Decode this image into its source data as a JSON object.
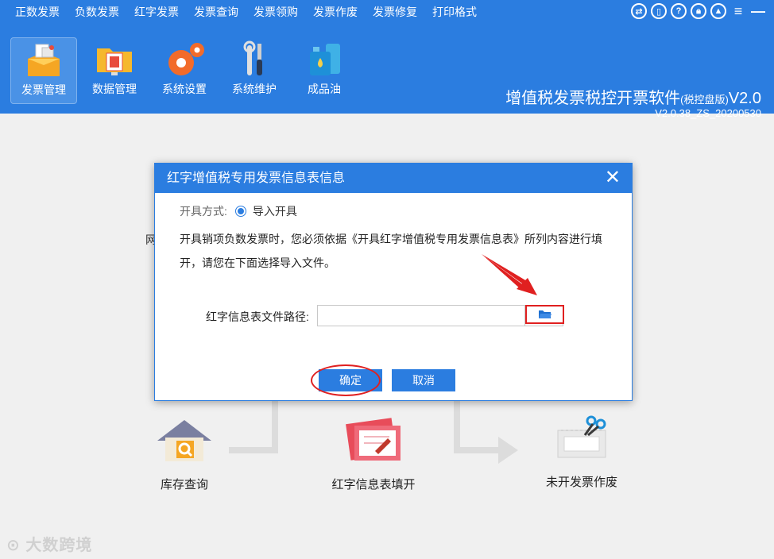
{
  "menu": [
    "正数发票",
    "负数发票",
    "红字发票",
    "发票查询",
    "发票领购",
    "发票作废",
    "发票修复",
    "打印格式"
  ],
  "window_icons": [
    "switch-icon",
    "tablet-icon",
    "help-icon",
    "lock-icon",
    "user-icon",
    "menu-icon",
    "minimize-icon"
  ],
  "toolbar": [
    {
      "label": "发票管理",
      "icon": "invoice-box-icon",
      "active": true
    },
    {
      "label": "数据管理",
      "icon": "folder-data-icon",
      "active": false
    },
    {
      "label": "系统设置",
      "icon": "gears-icon",
      "active": false
    },
    {
      "label": "系统维护",
      "icon": "tools-icon",
      "active": false
    },
    {
      "label": "成品油",
      "icon": "oil-can-icon",
      "active": false
    }
  ],
  "brand": {
    "title": "增值税发票税控开票软件",
    "edition": "(税控盘版)",
    "version_short": "V2.0",
    "version_full": "V2.0.38_ZS_20200530"
  },
  "background": {
    "partial_text": "网",
    "flow": [
      {
        "label": "库存查询",
        "icon": "house-search-icon"
      },
      {
        "label": "红字信息表填开",
        "icon": "red-form-pen-icon"
      },
      {
        "label": "未开发票作废",
        "icon": "scissors-ticket-icon"
      }
    ],
    "watermark": "大数跨境"
  },
  "dialog": {
    "title": "红字增值税专用发票信息表信息",
    "mode_key": "开具方式:",
    "mode_value": "导入开具",
    "description": "开具销项负数发票时，您必须依据《开具红字增值税专用发票信息表》所列内容进行填开，请您在下面选择导入文件。",
    "path_label": "红字信息表文件路径:",
    "path_value": "",
    "ok": "确定",
    "cancel": "取消"
  },
  "colors": {
    "accent": "#2b7de0",
    "highlight": "#e02020"
  }
}
